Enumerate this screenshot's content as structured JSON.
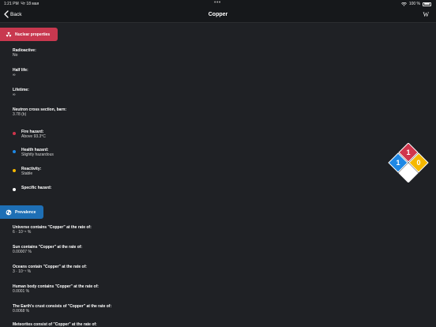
{
  "status_bar": {
    "time": "1:21 PM",
    "date": "Чт 18 мая",
    "battery": "100 %"
  },
  "nav": {
    "back_label": "Back",
    "title": "Copper",
    "wiki_label": "W"
  },
  "nuclear": {
    "header": "Nuclear properties",
    "items": [
      {
        "label": "Radioactive:",
        "value": "No"
      },
      {
        "label": "Half life:",
        "value": "∞"
      },
      {
        "label": "Lifetime:",
        "value": "∞"
      },
      {
        "label": "Neutron cross section, barn:",
        "value": "3.78 (b)"
      }
    ],
    "hazards": [
      {
        "label": "Fire hazard:",
        "value": "Above 93.3°C",
        "color": "#d0354c"
      },
      {
        "label": "Health hazard:",
        "value": "Slightly hazardous",
        "color": "#1e88e5"
      },
      {
        "label": "Reactivity:",
        "value": "Stable",
        "color": "#f5b800"
      },
      {
        "label": "Specific hazard:",
        "value": "",
        "color": "#ffffff"
      }
    ]
  },
  "nfpa": {
    "fire": "1",
    "health": "1",
    "reactivity": "0",
    "special": ""
  },
  "prevalence": {
    "header": "Prevalence",
    "items": [
      {
        "label": "Universe contains \"Copper\" at the rate of:",
        "value": "6 · 10⁻⁶ %"
      },
      {
        "label": "Sun contains \"Copper\" at the rate of:",
        "value": "0.00007 %"
      },
      {
        "label": "Oceans contain \"Copper\" at the rate of:",
        "value": "3 · 10⁻⁷ %"
      },
      {
        "label": "Human body contains \"Copper\" at the rate of:",
        "value": "0.0001 %"
      },
      {
        "label": "The Earth's crust consists of \"Copper\" at the rate of:",
        "value": "0.0068 %"
      },
      {
        "label": "Meteorites consist of \"Copper\" at the rate of:",
        "value": ""
      }
    ]
  }
}
